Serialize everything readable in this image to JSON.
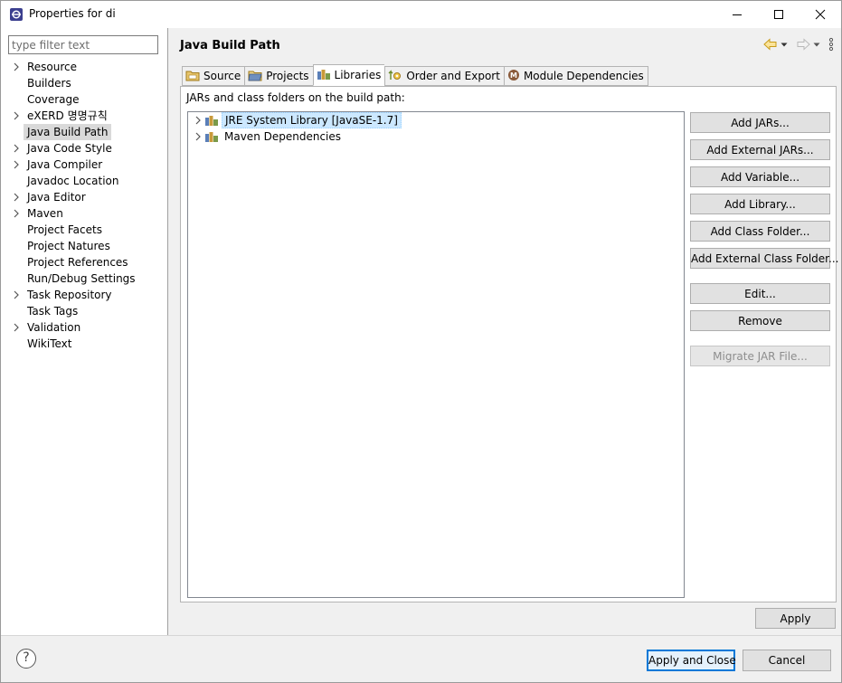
{
  "window": {
    "title": "Properties for di"
  },
  "left": {
    "filter_placeholder": "type filter text",
    "items": [
      {
        "label": "Resource",
        "expandable": true
      },
      {
        "label": "Builders",
        "expandable": false
      },
      {
        "label": "Coverage",
        "expandable": false
      },
      {
        "label": "eXERD 명명규칙",
        "expandable": true
      },
      {
        "label": "Java Build Path",
        "expandable": false,
        "selected": true
      },
      {
        "label": "Java Code Style",
        "expandable": true
      },
      {
        "label": "Java Compiler",
        "expandable": true
      },
      {
        "label": "Javadoc Location",
        "expandable": false
      },
      {
        "label": "Java Editor",
        "expandable": true
      },
      {
        "label": "Maven",
        "expandable": true
      },
      {
        "label": "Project Facets",
        "expandable": false
      },
      {
        "label": "Project Natures",
        "expandable": false
      },
      {
        "label": "Project References",
        "expandable": false
      },
      {
        "label": "Run/Debug Settings",
        "expandable": false
      },
      {
        "label": "Task Repository",
        "expandable": true
      },
      {
        "label": "Task Tags",
        "expandable": false
      },
      {
        "label": "Validation",
        "expandable": true
      },
      {
        "label": "WikiText",
        "expandable": false
      }
    ]
  },
  "main": {
    "title": "Java Build Path",
    "tabs": [
      {
        "label": "Source",
        "icon": "source-folder-icon"
      },
      {
        "label": "Projects",
        "icon": "projects-folder-icon"
      },
      {
        "label": "Libraries",
        "icon": "libraries-icon",
        "active": true
      },
      {
        "label": "Order and Export",
        "icon": "order-export-icon"
      },
      {
        "label": "Module Dependencies",
        "icon": "module-icon"
      }
    ],
    "section_label": "JARs and class folders on the build path:",
    "libraries": [
      {
        "label": "JRE System Library [JavaSE-1.7]",
        "selected": true
      },
      {
        "label": "Maven Dependencies",
        "selected": false
      }
    ],
    "buttons": {
      "add_jars": "Add JARs...",
      "add_external_jars": "Add External JARs...",
      "add_variable": "Add Variable...",
      "add_library": "Add Library...",
      "add_class_folder": "Add Class Folder...",
      "add_external_class_folder": "Add External Class Folder...",
      "edit": "Edit...",
      "remove": "Remove",
      "migrate_jar": "Migrate JAR File..."
    },
    "apply": "Apply"
  },
  "footer": {
    "apply_and_close": "Apply and Close",
    "cancel": "Cancel"
  },
  "colors": {
    "selection": "#cce8ff",
    "primary_border": "#0078d7"
  }
}
